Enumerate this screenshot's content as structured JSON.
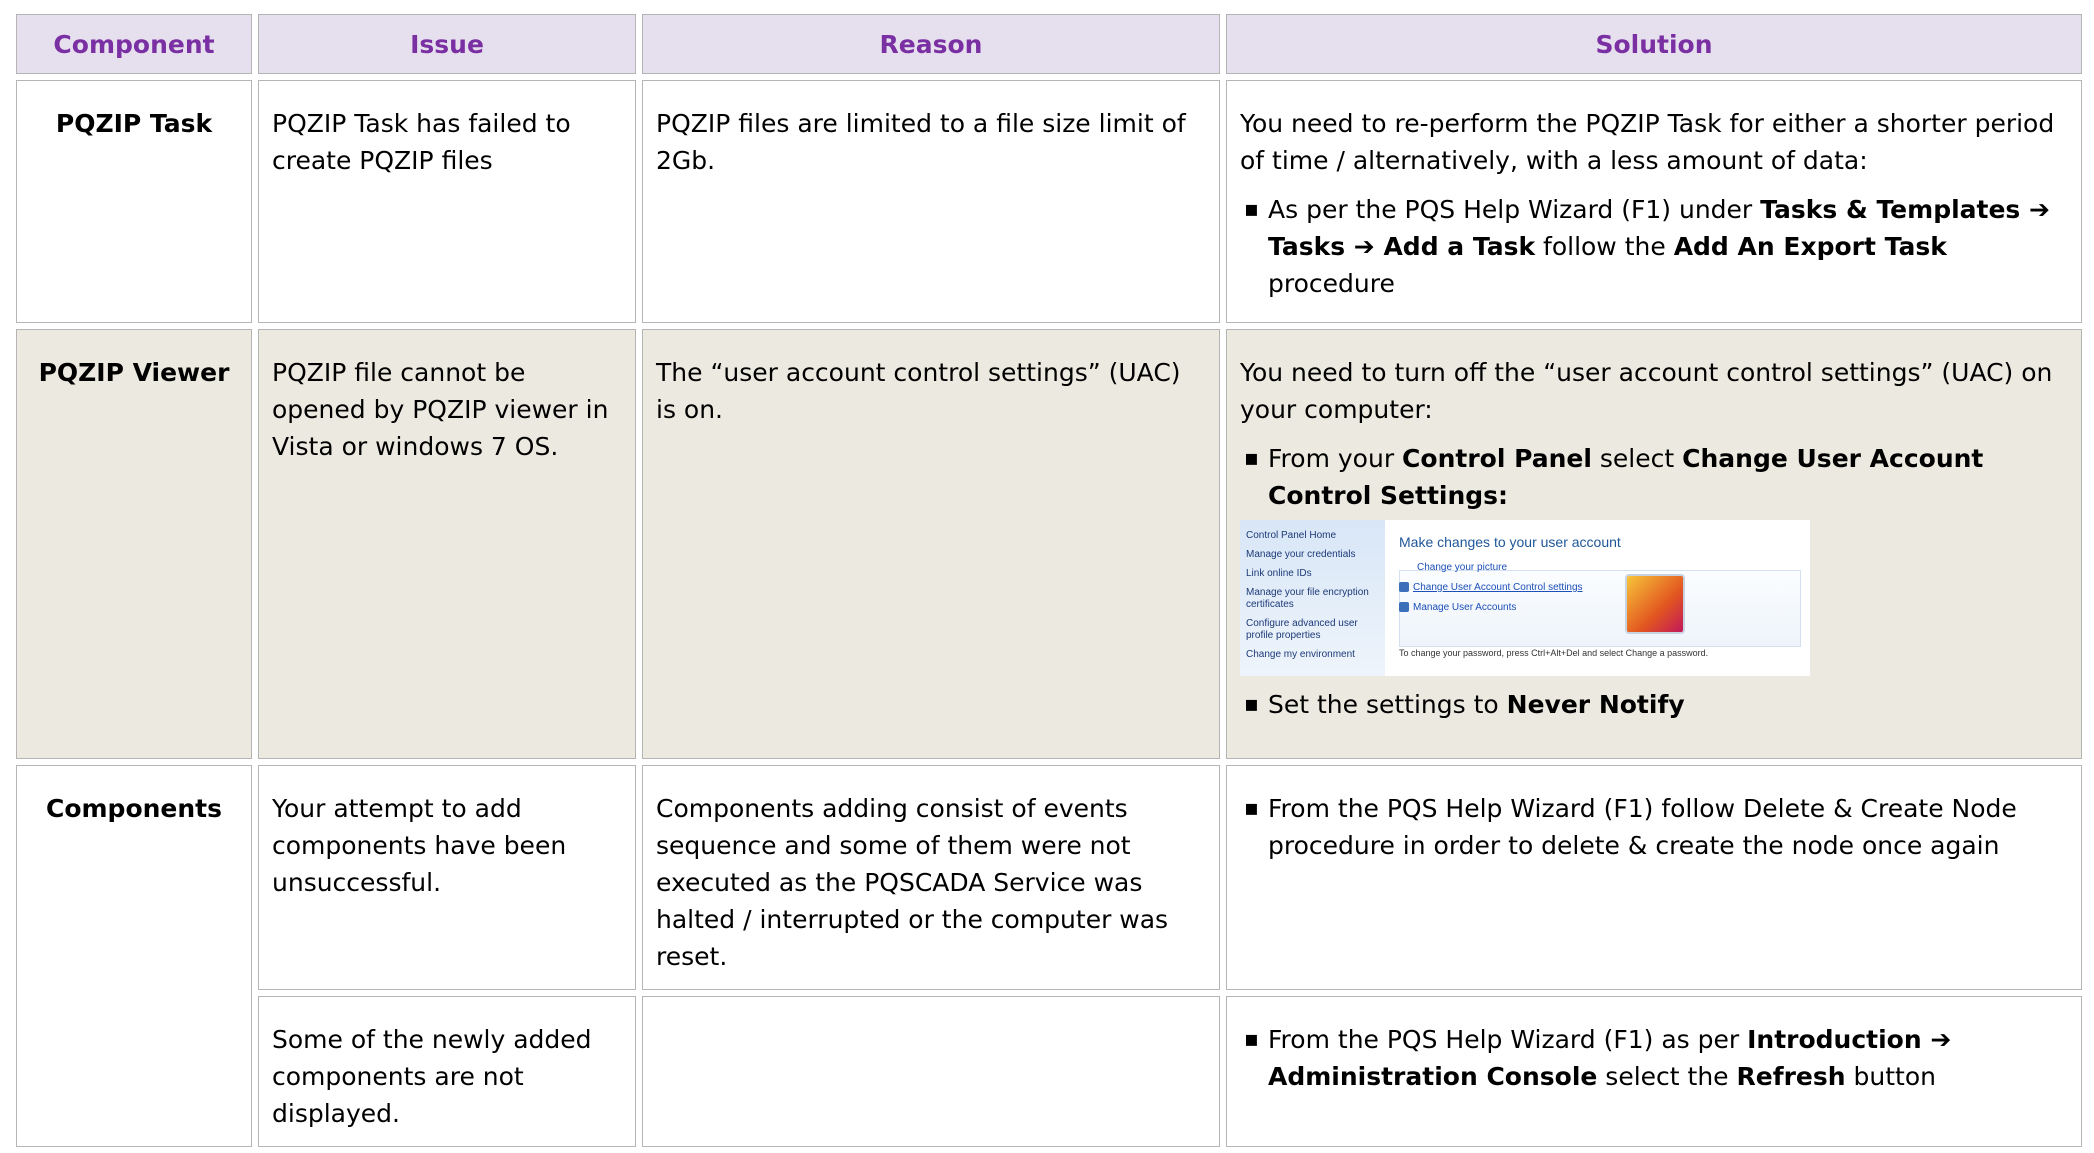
{
  "headers": {
    "component": "Component",
    "issue": "Issue",
    "reason": "Reason",
    "solution": "Solution"
  },
  "row1": {
    "component": "PQZIP Task",
    "issue": "PQZIP Task has failed to create PQZIP files",
    "reason": "PQZIP files are limited to a file size limit of 2Gb.",
    "solution_intro": "You need to re-perform the PQZIP Task for either a shorter period of time / alternatively, with a less amount of data:",
    "bullet": {
      "t1": "As per the PQS Help Wizard (F1) under ",
      "b1": "Tasks & Templates",
      "arrow1": " ➔ ",
      "b2": "Tasks",
      "arrow2": " ➔ ",
      "b3": "Add a Task",
      "t2": " follow the ",
      "b4": "Add An Export Task",
      "t3": " procedure"
    }
  },
  "row2": {
    "component": "PQZIP Viewer",
    "issue": "PQZIP file cannot be opened by PQZIP viewer in Vista or windows 7 OS.",
    "reason": "The “user account control settings” (UAC) is on.",
    "solution_intro": "You need to turn off the “user account control settings” (UAC) on your computer:",
    "bullet1": {
      "t1": "From your ",
      "b1": "Control Panel",
      "t2": " select ",
      "b2": "Change User Account Control Settings:"
    },
    "screenshot": {
      "left_items": [
        "Control Panel Home",
        "Manage your credentials",
        "Link online IDs",
        "Manage your file encryption certificates",
        "Configure advanced user profile properties",
        "Change my environment"
      ],
      "title": "Make changes to your user account",
      "link1": "Change your picture",
      "link2": "Change User Account Control settings",
      "link3": "Manage User Accounts",
      "note": "To change your password, press Ctrl+Alt+Del and select Change a password."
    },
    "bullet2": {
      "t1": "Set the settings to ",
      "b1": "Never Notify"
    }
  },
  "row3": {
    "component": "Components",
    "issue": "Your attempt to add components have been unsuccessful.",
    "reason": "Components adding consist of events sequence and some of them were not executed as the PQSCADA Service was halted / interrupted or the computer was reset.",
    "bullet": "From the PQS Help Wizard (F1) follow Delete & Create Node procedure in order to delete & create the node once again"
  },
  "row4": {
    "issue": "Some of the newly added components are not displayed.",
    "reason": "",
    "bullet": {
      "t1": "From the PQS Help Wizard (F1) as per ",
      "b1": "Introduction",
      "arrow1": " ➔ ",
      "b2": "Administration Console",
      "t2": " select the ",
      "b3": "Refresh",
      "t3": " button"
    }
  }
}
